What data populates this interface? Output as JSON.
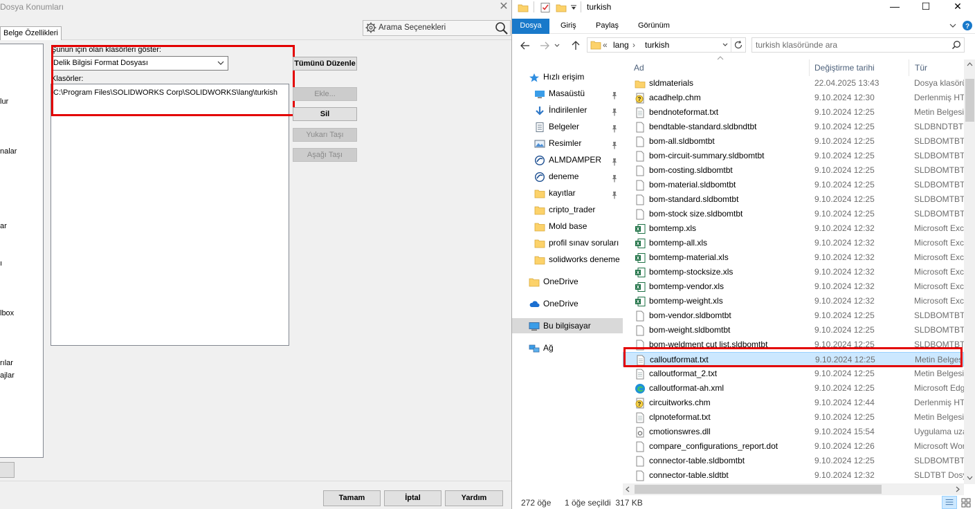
{
  "dialog": {
    "title": "Dosya Konumları",
    "tab": "Belge Özellikleri",
    "search_options": "Arama Seçenekleri",
    "left_list": [
      "lur",
      "nalar",
      "ar",
      "ı",
      "lbox",
      "rılar",
      "ajlar"
    ],
    "show_folders_label": "Şunun için olan klasörleri göster:",
    "combo_value": "Delik Bilgisi Format Dosyası",
    "folders_label": "Klasörler:",
    "folder_path": "C:\\Program Files\\SOLIDWORKS Corp\\SOLIDWORKS\\lang\\turkish",
    "edit_all": "Tümünü Düzenle",
    "add": "Ekle...",
    "delete": "Sil",
    "move_up": "Yukarı Taşı",
    "move_down": "Aşağı Taşı",
    "ok": "Tamam",
    "cancel": "İptal",
    "help": "Yardım"
  },
  "explorer": {
    "title": "turkish",
    "ribbon_tabs": [
      "Dosya",
      "Giriş",
      "Paylaş",
      "Görünüm"
    ],
    "address": {
      "prefix": "«",
      "parts": [
        "lang",
        "turkish"
      ],
      "sep": "›"
    },
    "search_placeholder": "turkish klasöründe ara",
    "columns": {
      "name": "Ad",
      "date": "Değiştirme tarihi",
      "type": "Tür"
    },
    "nav": [
      {
        "label": "Hızlı erişim",
        "icon": "star-icon",
        "pin": false
      },
      {
        "label": "Masaüstü",
        "icon": "desktop-icon",
        "pin": true
      },
      {
        "label": "İndirilenler",
        "icon": "download-icon",
        "pin": true
      },
      {
        "label": "Belgeler",
        "icon": "documents-icon",
        "pin": true
      },
      {
        "label": "Resimler",
        "icon": "pictures-icon",
        "pin": true
      },
      {
        "label": "ALMDAMPER",
        "icon": "solidworks-icon",
        "pin": true
      },
      {
        "label": "deneme",
        "icon": "solidworks-icon",
        "pin": true
      },
      {
        "label": "kayıtlar",
        "icon": "folder-icon",
        "pin": true
      },
      {
        "label": "cripto_trader",
        "icon": "folder-icon",
        "pin": false
      },
      {
        "label": "Mold base",
        "icon": "folder-icon",
        "pin": false
      },
      {
        "label": "profil sınav soruları",
        "icon": "folder-icon",
        "pin": false
      },
      {
        "label": "solidworks deneme",
        "icon": "folder-icon",
        "pin": false
      },
      {
        "label": "OneDrive",
        "icon": "folder-icon",
        "pin": false
      },
      {
        "label": "OneDrive",
        "icon": "cloud-icon",
        "pin": false
      },
      {
        "label": "Bu bilgisayar",
        "icon": "computer-icon",
        "pin": false
      },
      {
        "label": "Ağ",
        "icon": "network-icon",
        "pin": false
      }
    ],
    "files": [
      {
        "name": "sldmaterials",
        "date": "22.04.2025 13:43",
        "type": "Dosya klasörü",
        "icon": "folder"
      },
      {
        "name": "acadhelp.chm",
        "date": "9.10.2024 12:30",
        "type": "Derlenmiş HTML",
        "icon": "chm"
      },
      {
        "name": "bendnoteformat.txt",
        "date": "9.10.2024 12:25",
        "type": "Metin Belgesi",
        "icon": "txt"
      },
      {
        "name": "bendtable-standard.sldbndtbt",
        "date": "9.10.2024 12:25",
        "type": "SLDBNDTBT Dosyası",
        "icon": "file"
      },
      {
        "name": "bom-all.sldbomtbt",
        "date": "9.10.2024 12:25",
        "type": "SLDBOMTBT Dosyası",
        "icon": "file"
      },
      {
        "name": "bom-circuit-summary.sldbomtbt",
        "date": "9.10.2024 12:25",
        "type": "SLDBOMTBT Dosyası",
        "icon": "file"
      },
      {
        "name": "bom-costing.sldbomtbt",
        "date": "9.10.2024 12:25",
        "type": "SLDBOMTBT Dosyası",
        "icon": "file"
      },
      {
        "name": "bom-material.sldbomtbt",
        "date": "9.10.2024 12:25",
        "type": "SLDBOMTBT Dosyası",
        "icon": "file"
      },
      {
        "name": "bom-standard.sldbomtbt",
        "date": "9.10.2024 12:25",
        "type": "SLDBOMTBT Dosyası",
        "icon": "file"
      },
      {
        "name": "bom-stock size.sldbomtbt",
        "date": "9.10.2024 12:25",
        "type": "SLDBOMTBT Dosyası",
        "icon": "file"
      },
      {
        "name": "bomtemp.xls",
        "date": "9.10.2024 12:32",
        "type": "Microsoft Excel",
        "icon": "xls"
      },
      {
        "name": "bomtemp-all.xls",
        "date": "9.10.2024 12:32",
        "type": "Microsoft Excel",
        "icon": "xls"
      },
      {
        "name": "bomtemp-material.xls",
        "date": "9.10.2024 12:32",
        "type": "Microsoft Excel",
        "icon": "xls"
      },
      {
        "name": "bomtemp-stocksize.xls",
        "date": "9.10.2024 12:32",
        "type": "Microsoft Excel",
        "icon": "xls"
      },
      {
        "name": "bomtemp-vendor.xls",
        "date": "9.10.2024 12:32",
        "type": "Microsoft Excel",
        "icon": "xls"
      },
      {
        "name": "bomtemp-weight.xls",
        "date": "9.10.2024 12:32",
        "type": "Microsoft Excel",
        "icon": "xls"
      },
      {
        "name": "bom-vendor.sldbomtbt",
        "date": "9.10.2024 12:25",
        "type": "SLDBOMTBT Dosyası",
        "icon": "file"
      },
      {
        "name": "bom-weight.sldbomtbt",
        "date": "9.10.2024 12:25",
        "type": "SLDBOMTBT Dosyası",
        "icon": "file"
      },
      {
        "name": "bom-weldment cut list.sldbomtbt",
        "date": "9.10.2024 12:25",
        "type": "SLDBOMTBT Dosyası",
        "icon": "file"
      },
      {
        "name": "calloutformat.txt",
        "date": "9.10.2024 12:25",
        "type": "Metin Belgesi",
        "icon": "txt",
        "selected": true
      },
      {
        "name": "calloutformat_2.txt",
        "date": "9.10.2024 12:25",
        "type": "Metin Belgesi",
        "icon": "txt"
      },
      {
        "name": "calloutformat-ah.xml",
        "date": "9.10.2024 12:25",
        "type": "Microsoft Edge",
        "icon": "edge"
      },
      {
        "name": "circuitworks.chm",
        "date": "9.10.2024 12:44",
        "type": "Derlenmiş HTML",
        "icon": "chm"
      },
      {
        "name": "clpnoteformat.txt",
        "date": "9.10.2024 12:25",
        "type": "Metin Belgesi",
        "icon": "txt"
      },
      {
        "name": "cmotionswres.dll",
        "date": "9.10.2024 15:54",
        "type": "Uygulama uzantısı",
        "icon": "dll"
      },
      {
        "name": "compare_configurations_report.dot",
        "date": "9.10.2024 12:26",
        "type": "Microsoft Word",
        "icon": "file"
      },
      {
        "name": "connector-table.sldbomtbt",
        "date": "9.10.2024 12:25",
        "type": "SLDBOMTBT Dosyası",
        "icon": "file"
      },
      {
        "name": "connector-table.sldtbt",
        "date": "9.10.2024 12:32",
        "type": "SLDTBT Dosyası",
        "icon": "file"
      }
    ],
    "status": {
      "count": "272 öğe",
      "selected": "1 öğe seçildi  317 KB"
    },
    "accent_color": "#1979ca",
    "highlight_color": "#e30000"
  }
}
